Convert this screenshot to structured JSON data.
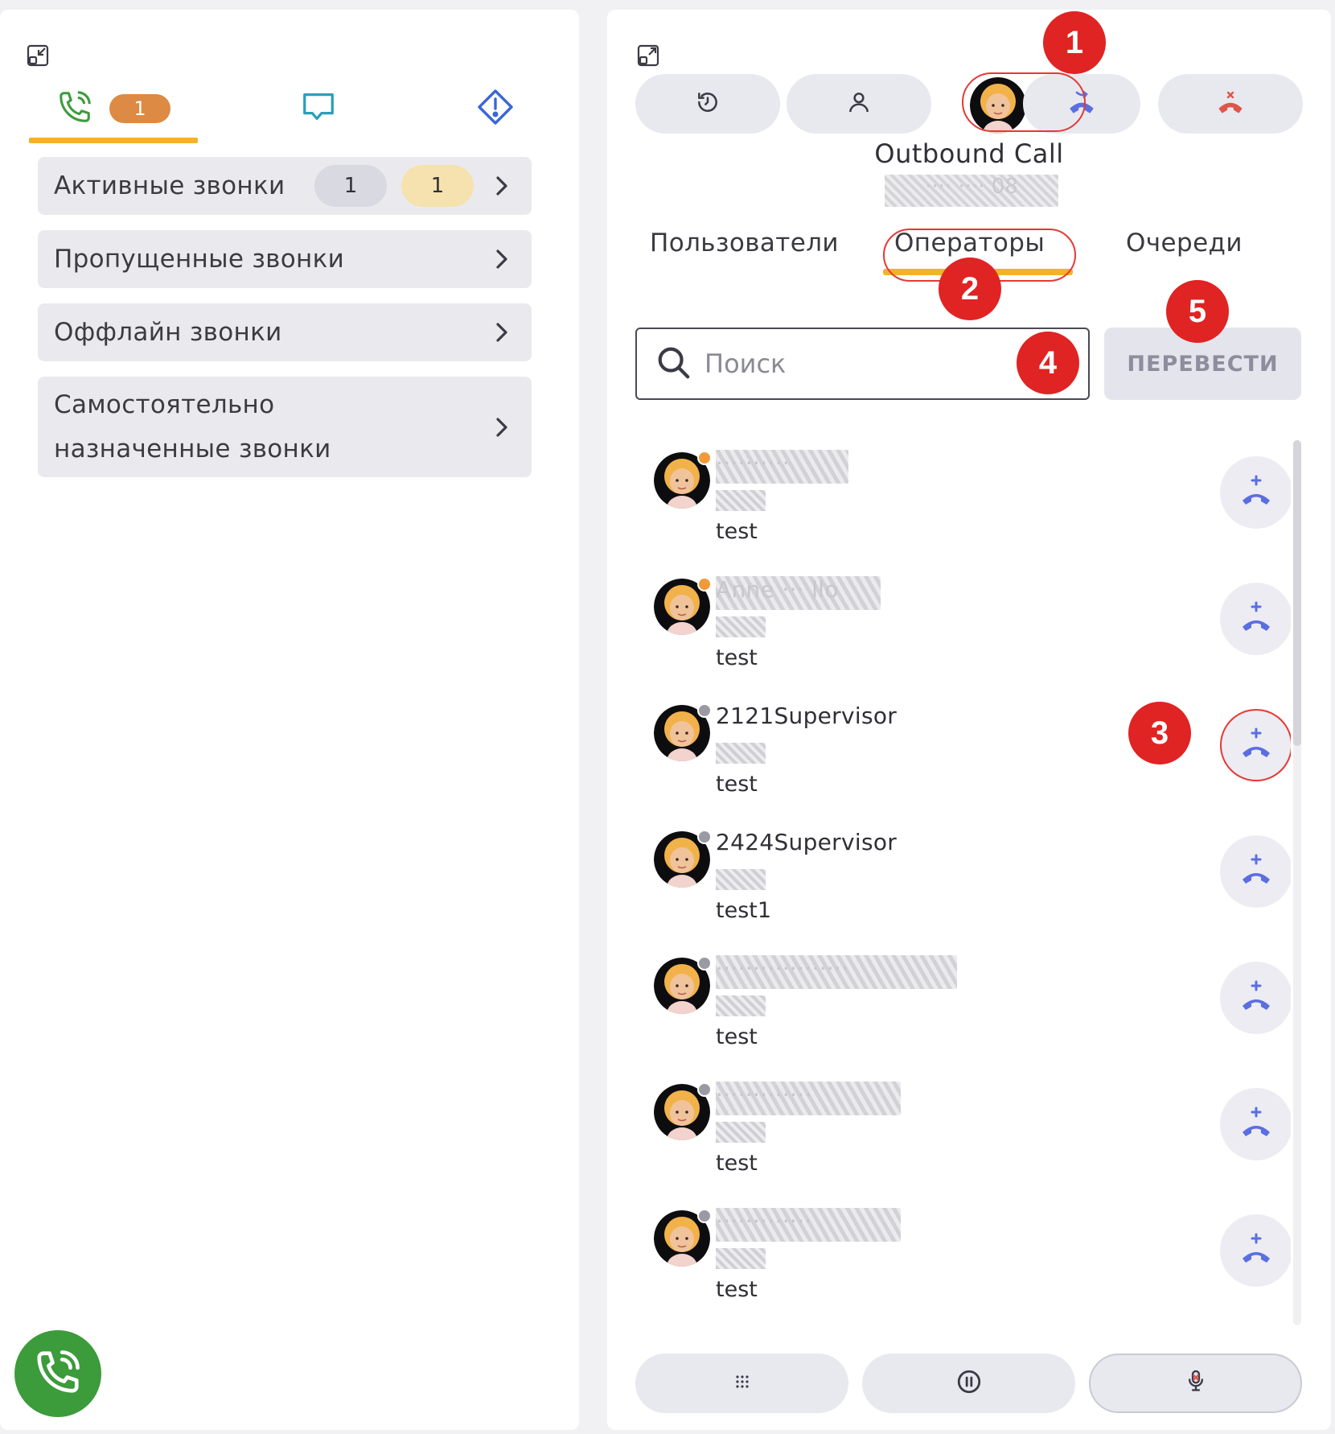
{
  "left": {
    "tabs": {
      "calls_count": "1"
    },
    "menu": [
      {
        "label": "Активные звонки",
        "badge_gray": "1",
        "badge_yellow": "1"
      },
      {
        "label": "Пропущенные звонки"
      },
      {
        "label": "Оффлайн звонки"
      },
      {
        "label": "Самостоятельно назначенные звонки"
      }
    ]
  },
  "right": {
    "call_title": "Outbound Call",
    "call_number": "···· ···· 08",
    "sub_tabs": [
      "Пользователи",
      "Операторы",
      "Очереди"
    ],
    "search_placeholder": "Поиск",
    "transfer_label": "ПЕРЕВЕСТИ",
    "operators": [
      {
        "name": "··········",
        "ext": "····",
        "group": "test",
        "status": "paused"
      },
      {
        "name": "Anne ··· llo",
        "ext": "····",
        "group": "test",
        "status": "paused"
      },
      {
        "name": "2121Supervisor",
        "ext": "····",
        "group": "test",
        "status": "offline"
      },
      {
        "name": "2424Supervisor",
        "ext": "····",
        "group": "test1",
        "status": "offline"
      },
      {
        "name": "··················",
        "ext": "····",
        "group": "test",
        "status": "offline"
      },
      {
        "name": "·············",
        "ext": "····",
        "group": "test",
        "status": "offline"
      },
      {
        "name": "·············",
        "ext": "····",
        "group": "test",
        "status": "offline"
      }
    ]
  },
  "annotations": [
    "1",
    "2",
    "3",
    "4",
    "5"
  ],
  "colors": {
    "accent_yellow": "#f2b32a",
    "green": "#3c9b3b",
    "blue": "#5b6ee1",
    "red_marker": "#e02323",
    "orange_badge": "#dd8a45"
  }
}
